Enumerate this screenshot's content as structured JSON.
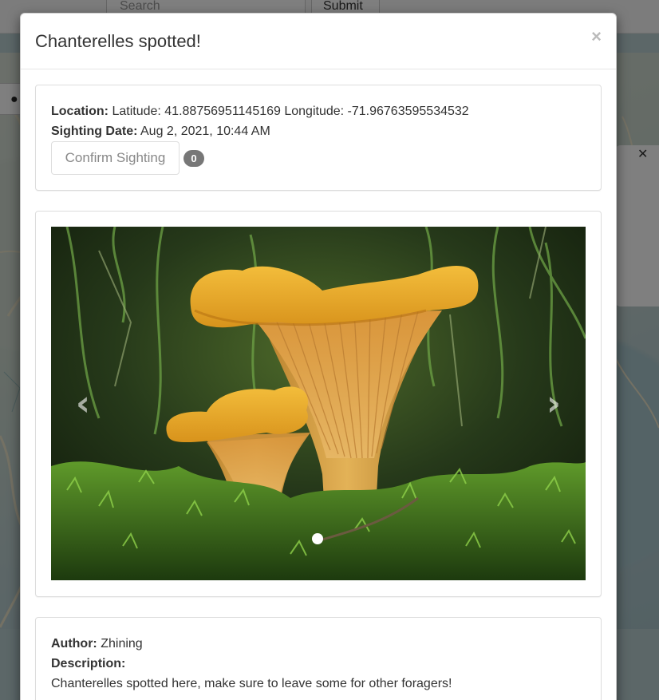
{
  "background": {
    "search_placeholder": "Search",
    "submit_label": "Submit"
  },
  "modal": {
    "title": "Chanterelles spotted!",
    "close_glyph": "×",
    "info": {
      "location_label": "Location:",
      "location_value": "Latitude: 41.88756951145169 Longitude: -71.96763595534532",
      "date_label": "Sighting Date:",
      "date_value": "Aug 2, 2021, 10:44 AM",
      "confirm_label": "Confirm Sighting",
      "confirm_count": "0"
    },
    "carousel": {
      "prev_glyph": "‹",
      "next_glyph": "›",
      "slide_count": 1,
      "active_index": 0
    },
    "details": {
      "author_label": "Author:",
      "author_value": "Zhining",
      "description_label": "Description:",
      "description_value": "Chanterelles spotted here, make sure to leave some for other foragers!"
    }
  },
  "colors": {
    "backdrop": "rgba(0,0,0,0.5)",
    "badge": "#777777",
    "mushroom_cap": "#e8a624",
    "moss": "#3f7a1c"
  }
}
